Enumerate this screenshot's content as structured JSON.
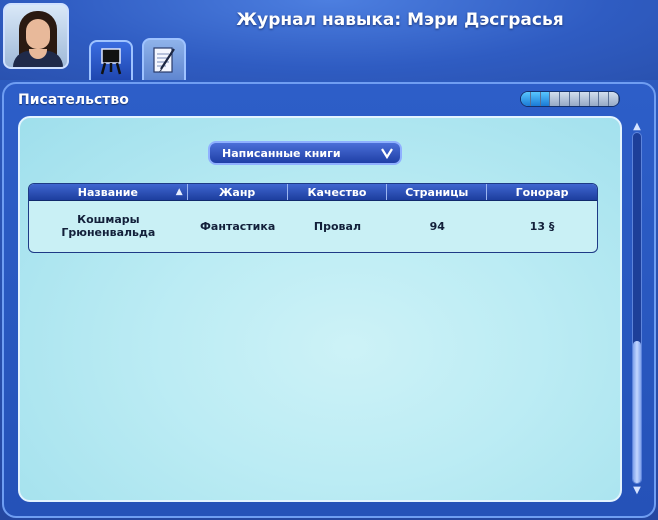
{
  "window": {
    "title": "Журнал навыка: Мэри Дэсграсья"
  },
  "tabs": [
    {
      "icon": "easel-icon",
      "active": false
    },
    {
      "icon": "notepad-pen-icon",
      "active": true
    }
  ],
  "skill": {
    "name": "Писательство",
    "level": 3,
    "max_level": 10
  },
  "dropdown": {
    "selected": "Написанные книги"
  },
  "table": {
    "columns": [
      "Название",
      "Жанр",
      "Качество",
      "Страницы",
      "Гонорар"
    ],
    "sorted_column": "Название",
    "rows": [
      {
        "title": "Кошмары Грюненвальда",
        "genre": "Фантастика",
        "quality": "Провал",
        "pages": "94",
        "royalty": "13 §"
      }
    ]
  },
  "colors": {
    "accent": "#2a54b4",
    "content_bg": "#bcecf4",
    "header_bar": "#1d3e9e"
  }
}
